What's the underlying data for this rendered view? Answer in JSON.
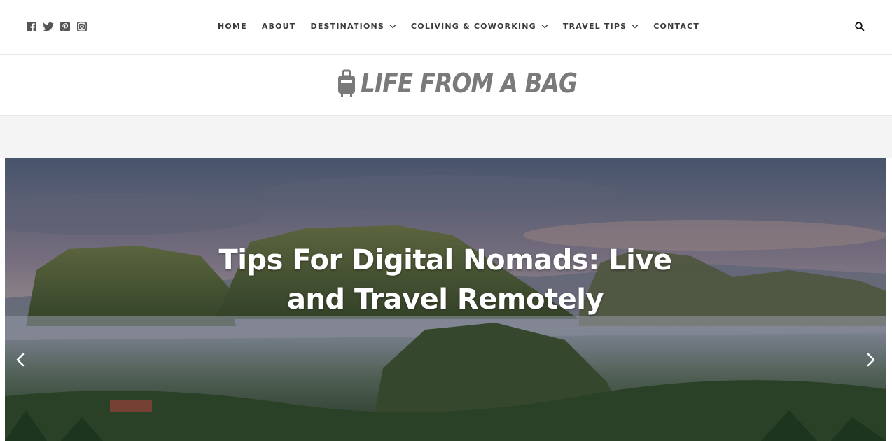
{
  "social": {
    "icons": [
      "facebook-icon",
      "twitter-icon",
      "pinterest-icon",
      "instagram-icon"
    ],
    "color": "#555555"
  },
  "nav": {
    "items": [
      {
        "label": "HOME",
        "has_dropdown": false
      },
      {
        "label": "ABOUT",
        "has_dropdown": false
      },
      {
        "label": "DESTINATIONS",
        "has_dropdown": true
      },
      {
        "label": "COLIVING & COWORKING",
        "has_dropdown": true
      },
      {
        "label": "TRAVEL TIPS",
        "has_dropdown": true
      },
      {
        "label": "CONTACT",
        "has_dropdown": false
      }
    ],
    "search_icon": "search-icon"
  },
  "logo": {
    "text": "LIFE FROM A BAG",
    "icon": "suitcase-icon",
    "color": "#7a7a7a"
  },
  "hero": {
    "title": "Tips For Digital Nomads: Live and Travel Remotely",
    "prev_icon": "chevron-left-icon",
    "next_icon": "chevron-right-icon"
  }
}
